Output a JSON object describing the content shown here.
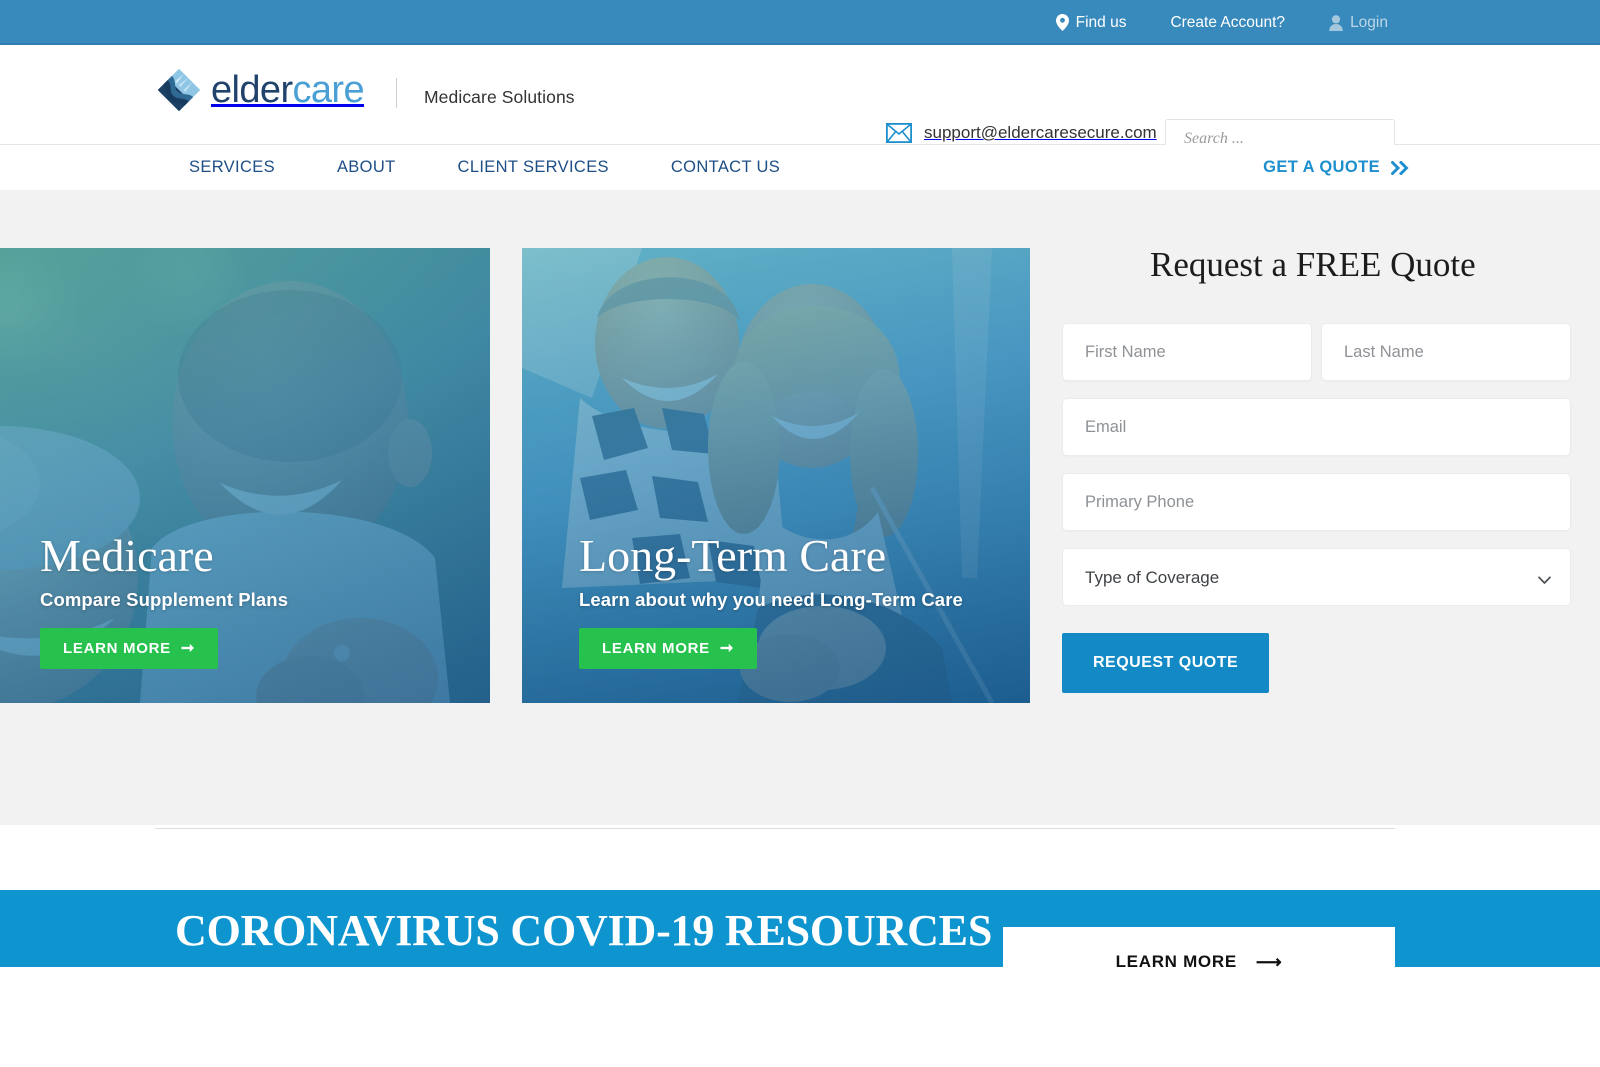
{
  "topbar": {
    "find_us": "Find us",
    "create_account": "Create Account?",
    "login": "Login",
    "bg_color": "#3889bc"
  },
  "header": {
    "logo_part1": "elder",
    "logo_part2": "care",
    "tagline": "Medicare Solutions",
    "email": "support@eldercaresecure.com",
    "search_placeholder": "Search ..."
  },
  "nav": {
    "items": [
      {
        "label": "SERVICES"
      },
      {
        "label": "ABOUT"
      },
      {
        "label": "CLIENT SERVICES"
      },
      {
        "label": "CONTACT US"
      }
    ],
    "quote_label": "GET A QUOTE",
    "link_color": "#1d4e85",
    "quote_color": "#1e8fce"
  },
  "hero": {
    "cards": [
      {
        "title": "Medicare",
        "subtitle": "Compare Supplement Plans",
        "button_label": "LEARN MORE"
      },
      {
        "title": "Long-Term Care",
        "subtitle": "Learn about why you need Long-Term Care",
        "button_label": "LEARN MORE"
      }
    ],
    "button_color": "#27c14d"
  },
  "quote_form": {
    "heading": "Request a FREE Quote",
    "first_name_placeholder": "First Name",
    "last_name_placeholder": "Last Name",
    "email_placeholder": "Email",
    "phone_placeholder": "Primary Phone",
    "coverage_selected": "Type of Coverage",
    "coverage_options": [
      "Type of Coverage"
    ],
    "submit_label": "REQUEST QUOTE",
    "submit_color": "#1389c6"
  },
  "covid_banner": {
    "title": "CORONAVIRUS COVID-19 RESOURCES",
    "button_label": "LEARN MORE",
    "bg_color": "#0e95cf"
  }
}
